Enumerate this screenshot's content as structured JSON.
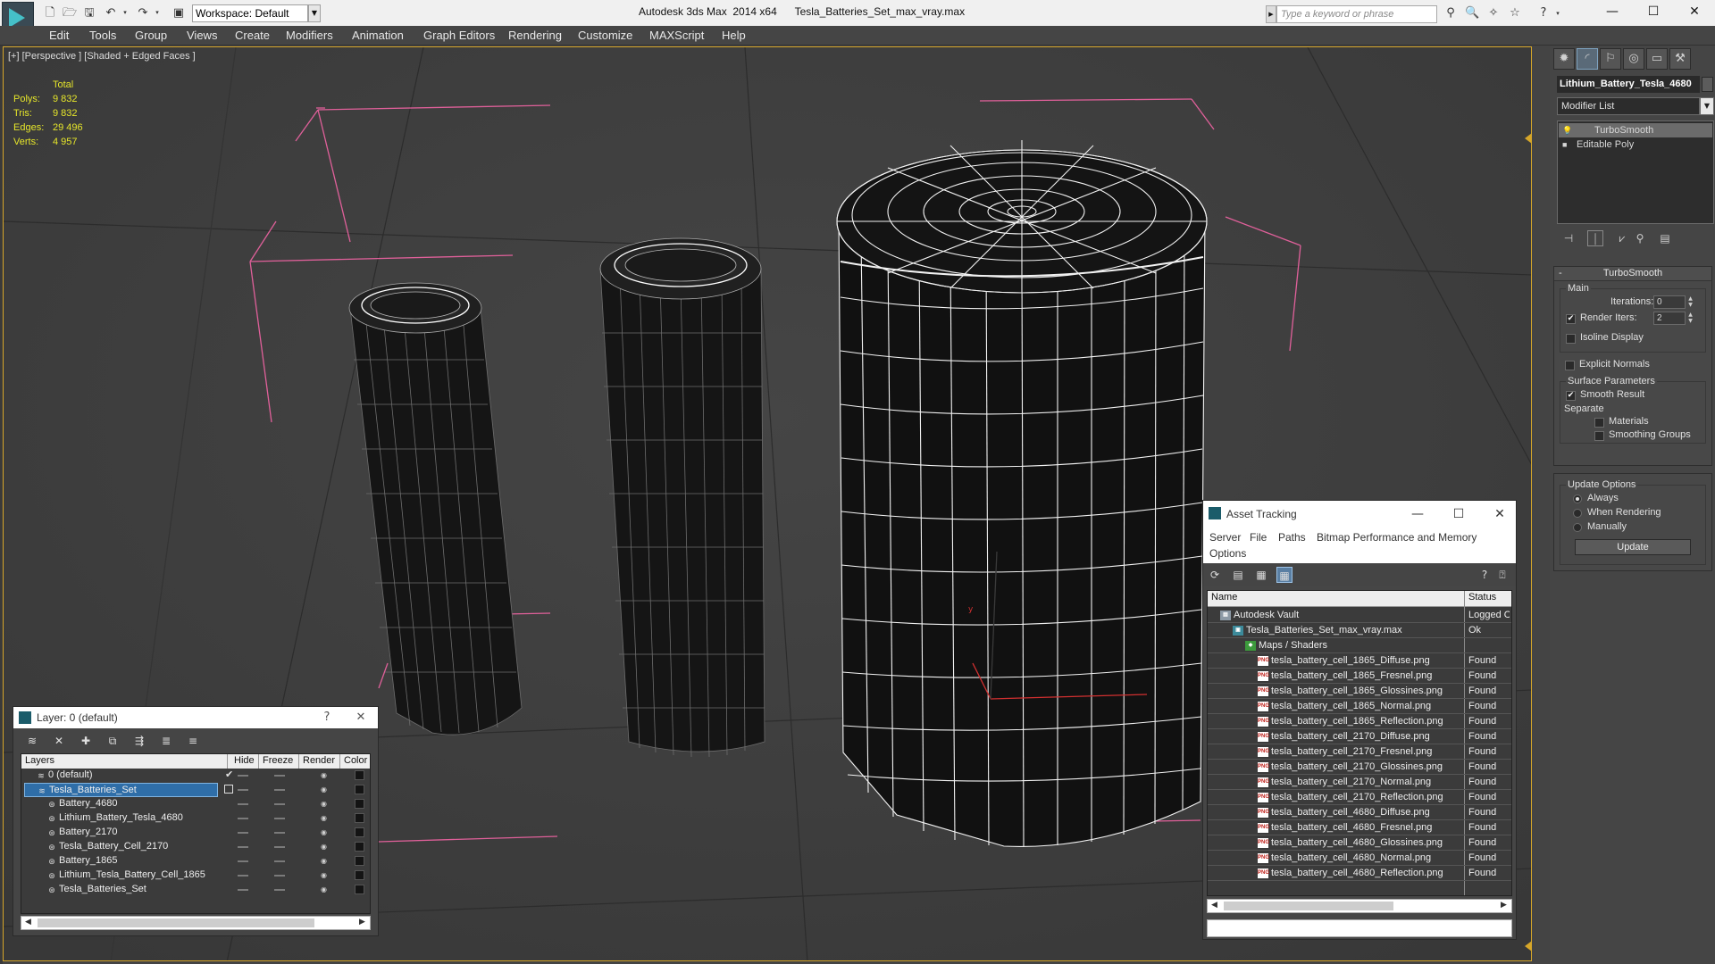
{
  "titlebar": {
    "workspace_label": "Workspace: Default",
    "app_title": "Autodesk 3ds Max  2014 x64",
    "file_title": "Tesla_Batteries_Set_max_vray.max",
    "search_placeholder": "Type a keyword or phrase",
    "icons": [
      "new-file-icon",
      "open-file-icon",
      "save-icon",
      "undo-icon",
      "redo-icon",
      "project-folder-icon",
      "binoculars-icon",
      "search-icon",
      "communication-icon",
      "favorites-icon",
      "help-icon"
    ],
    "window_buttons": {
      "minimize": "—",
      "maximize": "☐",
      "close": "✕"
    }
  },
  "menubar": {
    "items": [
      "Edit",
      "Tools",
      "Group",
      "Views",
      "Create",
      "Modifiers",
      "Animation",
      "Graph Editors",
      "Rendering",
      "Customize",
      "MAXScript",
      "Help"
    ]
  },
  "viewport": {
    "label": "[+] [Perspective ] [Shaded + Edged Faces ]",
    "stats": {
      "header": "Total",
      "rows": [
        {
          "label": "Polys:",
          "value": "9 832"
        },
        {
          "label": "Tris:",
          "value": "9 832"
        },
        {
          "label": "Edges:",
          "value": "29 496"
        },
        {
          "label": "Verts:",
          "value": "4 957"
        }
      ]
    },
    "colors": {
      "active_border": "#d6a629",
      "stats_text": "#e6e62a",
      "bounding_box": "#e0609a",
      "wireframe": "#ffffff"
    }
  },
  "command_panel": {
    "tabs": [
      "create-icon",
      "modify-icon",
      "hierarchy-icon",
      "motion-icon",
      "display-icon",
      "utilities-icon"
    ],
    "object_name": "Lithium_Battery_Tesla_4680",
    "modifier_list": "Modifier List",
    "stack": [
      {
        "label": "TurboSmooth",
        "selected": true
      },
      {
        "label": "Editable Poly",
        "selected": false
      }
    ],
    "turbosmooth": {
      "title": "TurboSmooth",
      "main_label": "Main",
      "iterations_label": "Iterations:",
      "iterations_value": "0",
      "render_iters_label": "Render Iters:",
      "render_iters_value": "2",
      "render_iters_checked": true,
      "isoline_label": "Isoline Display",
      "explicit_normals_label": "Explicit Normals",
      "surface_params_label": "Surface Parameters",
      "smooth_result_label": "Smooth Result",
      "separate_label": "Separate",
      "materials_label": "Materials",
      "smoothing_groups_label": "Smoothing Groups",
      "update_options_label": "Update Options",
      "always_label": "Always",
      "when_rendering_label": "When Rendering",
      "manually_label": "Manually",
      "update_button": "Update"
    }
  },
  "asset_tracking": {
    "title": "Asset Tracking",
    "menu": [
      "Server",
      "File",
      "Paths",
      "Bitmap Performance and Memory",
      "Options"
    ],
    "columns": {
      "name": "Name",
      "status": "Status"
    },
    "rows": [
      {
        "name": "Autodesk Vault",
        "status": "Logged Out",
        "icon": "vault-icon",
        "level": 0
      },
      {
        "name": "Tesla_Batteries_Set_max_vray.max",
        "status": "Ok",
        "icon": "max-file-icon",
        "level": 1
      },
      {
        "name": "Maps / Shaders",
        "status": "",
        "icon": "maps-icon",
        "level": 2
      },
      {
        "name": "tesla_battery_cell_1865_Diffuse.png",
        "status": "Found",
        "icon": "png-icon",
        "level": 3
      },
      {
        "name": "tesla_battery_cell_1865_Fresnel.png",
        "status": "Found",
        "icon": "png-icon",
        "level": 3
      },
      {
        "name": "tesla_battery_cell_1865_Glossines.png",
        "status": "Found",
        "icon": "png-icon",
        "level": 3
      },
      {
        "name": "tesla_battery_cell_1865_Normal.png",
        "status": "Found",
        "icon": "png-icon",
        "level": 3
      },
      {
        "name": "tesla_battery_cell_1865_Reflection.png",
        "status": "Found",
        "icon": "png-icon",
        "level": 3
      },
      {
        "name": "tesla_battery_cell_2170_Diffuse.png",
        "status": "Found",
        "icon": "png-icon",
        "level": 3
      },
      {
        "name": "tesla_battery_cell_2170_Fresnel.png",
        "status": "Found",
        "icon": "png-icon",
        "level": 3
      },
      {
        "name": "tesla_battery_cell_2170_Glossines.png",
        "status": "Found",
        "icon": "png-icon",
        "level": 3
      },
      {
        "name": "tesla_battery_cell_2170_Normal.png",
        "status": "Found",
        "icon": "png-icon",
        "level": 3
      },
      {
        "name": "tesla_battery_cell_2170_Reflection.png",
        "status": "Found",
        "icon": "png-icon",
        "level": 3
      },
      {
        "name": "tesla_battery_cell_4680_Diffuse.png",
        "status": "Found",
        "icon": "png-icon",
        "level": 3
      },
      {
        "name": "tesla_battery_cell_4680_Fresnel.png",
        "status": "Found",
        "icon": "png-icon",
        "level": 3
      },
      {
        "name": "tesla_battery_cell_4680_Glossines.png",
        "status": "Found",
        "icon": "png-icon",
        "level": 3
      },
      {
        "name": "tesla_battery_cell_4680_Normal.png",
        "status": "Found",
        "icon": "png-icon",
        "level": 3
      },
      {
        "name": "tesla_battery_cell_4680_Reflection.png",
        "status": "Found",
        "icon": "png-icon",
        "level": 3
      }
    ]
  },
  "layer_panel": {
    "title": "Layer: 0 (default)",
    "help": "?",
    "close": "✕",
    "columns": [
      "Layers",
      "Hide",
      "Freeze",
      "Render",
      "Color"
    ],
    "rows": [
      {
        "name": "0 (default)",
        "level": 0,
        "selected": false,
        "current": true
      },
      {
        "name": "Tesla_Batteries_Set",
        "level": 0,
        "selected": true,
        "current": false
      },
      {
        "name": "Battery_4680",
        "level": 1,
        "selected": false,
        "current": false
      },
      {
        "name": "Lithium_Battery_Tesla_4680",
        "level": 1,
        "selected": false,
        "current": false
      },
      {
        "name": "Battery_2170",
        "level": 1,
        "selected": false,
        "current": false
      },
      {
        "name": "Tesla_Battery_Cell_2170",
        "level": 1,
        "selected": false,
        "current": false
      },
      {
        "name": "Battery_1865",
        "level": 1,
        "selected": false,
        "current": false
      },
      {
        "name": "Lithium_Tesla_Battery_Cell_1865",
        "level": 1,
        "selected": false,
        "current": false
      },
      {
        "name": "Tesla_Batteries_Set",
        "level": 1,
        "selected": false,
        "current": false
      }
    ]
  }
}
